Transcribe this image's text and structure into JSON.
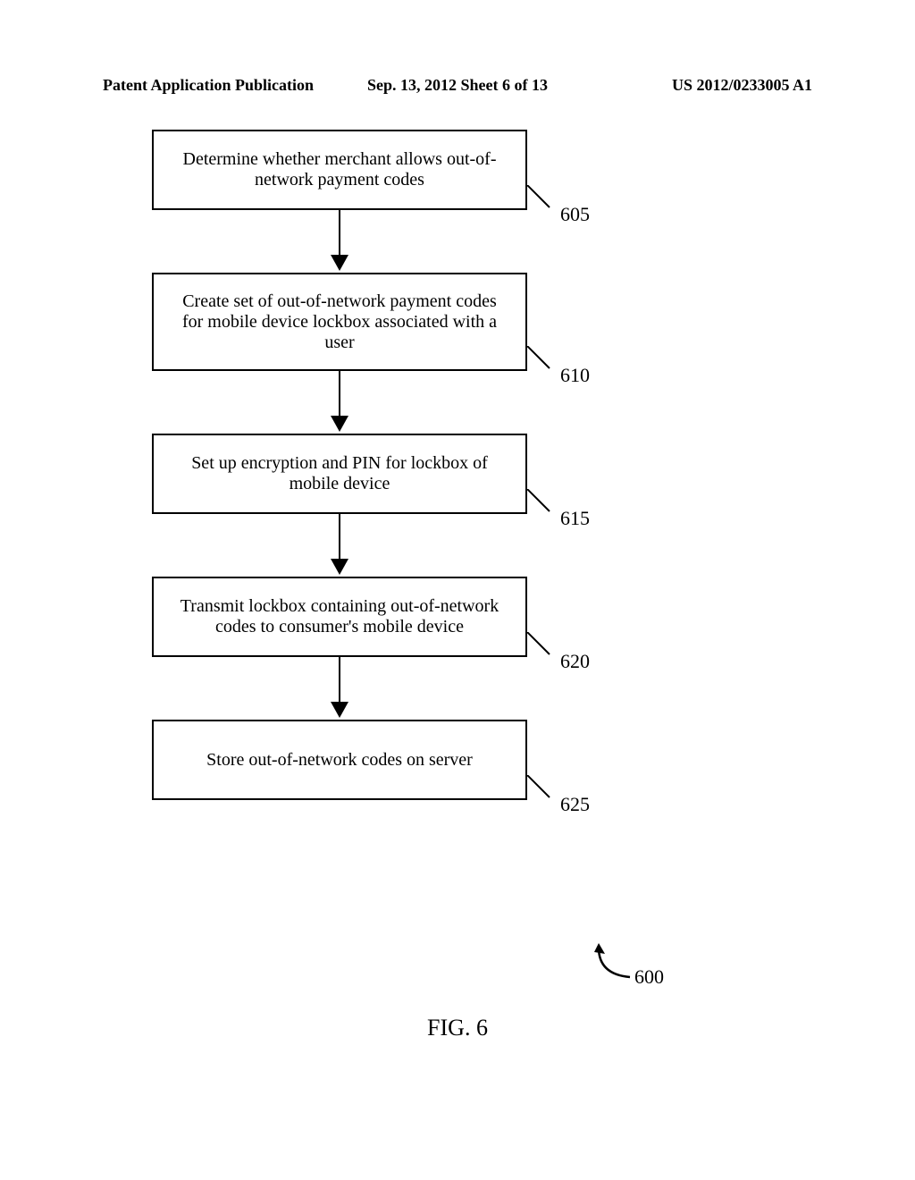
{
  "header": {
    "left": "Patent Application Publication",
    "center": "Sep. 13, 2012  Sheet 6 of 13",
    "right": "US 2012/0233005 A1"
  },
  "flowchart": {
    "boxes": [
      {
        "text": "Determine whether merchant allows out-of-network payment codes",
        "ref": "605"
      },
      {
        "text": "Create set of out-of-network payment codes for mobile device lockbox associated with a user",
        "ref": "610"
      },
      {
        "text": "Set up encryption and PIN for lockbox of mobile device",
        "ref": "615"
      },
      {
        "text": "Transmit lockbox containing out-of-network codes to consumer's mobile device",
        "ref": "620"
      },
      {
        "text": "Store out-of-network codes on server",
        "ref": "625"
      }
    ]
  },
  "figure": {
    "label": "FIG. 6",
    "ref": "600"
  }
}
